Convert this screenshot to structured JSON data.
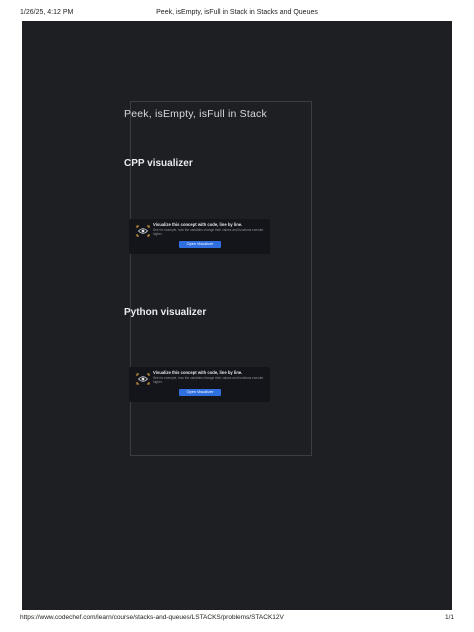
{
  "print_header": {
    "datetime": "1/26/25, 4:12 PM",
    "title": "Peek, isEmpty, isFull in Stack in Stacks and Queues"
  },
  "content": {
    "page_heading": "Peek, isEmpty, isFull in Stack",
    "sections": [
      {
        "heading": "CPP visualizer",
        "card": {
          "icon": "eye-icon",
          "title": "Visualize this concept with code, line by line.",
          "subtitle": "See for example, how the variables change their values and functions execute higher.",
          "button_label": "Open Visualizer"
        }
      },
      {
        "heading": "Python visualizer",
        "card": {
          "icon": "eye-icon",
          "title": "Visualize this concept with code, line by line.",
          "subtitle": "See for example, how the variables change their values and functions execute higher.",
          "button_label": "Open Visualizer"
        }
      }
    ]
  },
  "print_footer": {
    "url": "https://www.codechef.com/learn/course/stacks-and-queues/LSTACKS/problems/STACK12V",
    "page_count": "1/1"
  },
  "colors": {
    "page_background": "#1e1f23",
    "card_background": "#14151a",
    "accent_button": "#2f6fe0",
    "icon_accent": "#e0a640"
  }
}
